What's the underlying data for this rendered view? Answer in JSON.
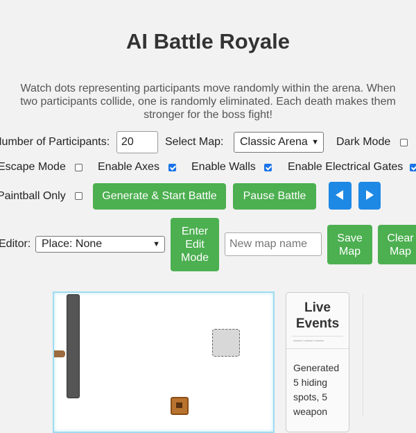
{
  "header": {
    "title": "AI Battle Royale",
    "subtitle": "Watch dots representing participants move randomly within the arena. When two participants collide, one is randomly eliminated. Each death makes them stronger for the boss fight!"
  },
  "controls": {
    "participants_label": "Number of Participants:",
    "participants_value": "20",
    "map_label": "Select Map:",
    "map_selected": "Classic Arena",
    "dark_mode_label": "Dark Mode",
    "dark_mode": false,
    "escape_mode_label": "Escape Mode",
    "escape_mode": false,
    "axes_label": "Enable Axes",
    "axes": true,
    "walls_label": "Enable Walls",
    "walls": true,
    "gates_label": "Enable Electrical Gates",
    "gates": true,
    "paintball_label": "Paintball Only",
    "paintball": false,
    "generate_button": "Generate & Start Battle",
    "pause_button": "Pause Battle",
    "prev_icon": "left-triangle-icon",
    "next_icon": "right-triangle-icon"
  },
  "editor": {
    "label": "Editor:",
    "place_selected": "Place: None",
    "edit_mode_button": "Enter Edit Mode",
    "map_name_placeholder": "New map name",
    "save_button": "Save Map",
    "clear_button": "Clear Map"
  },
  "events": {
    "title": "Live Events",
    "latest": "Generated 5 hiding spots, 5 weapon"
  },
  "colors": {
    "button_green": "#4caf50",
    "button_blue": "#1e88e5",
    "checkbox_blue": "#1a73e8"
  }
}
